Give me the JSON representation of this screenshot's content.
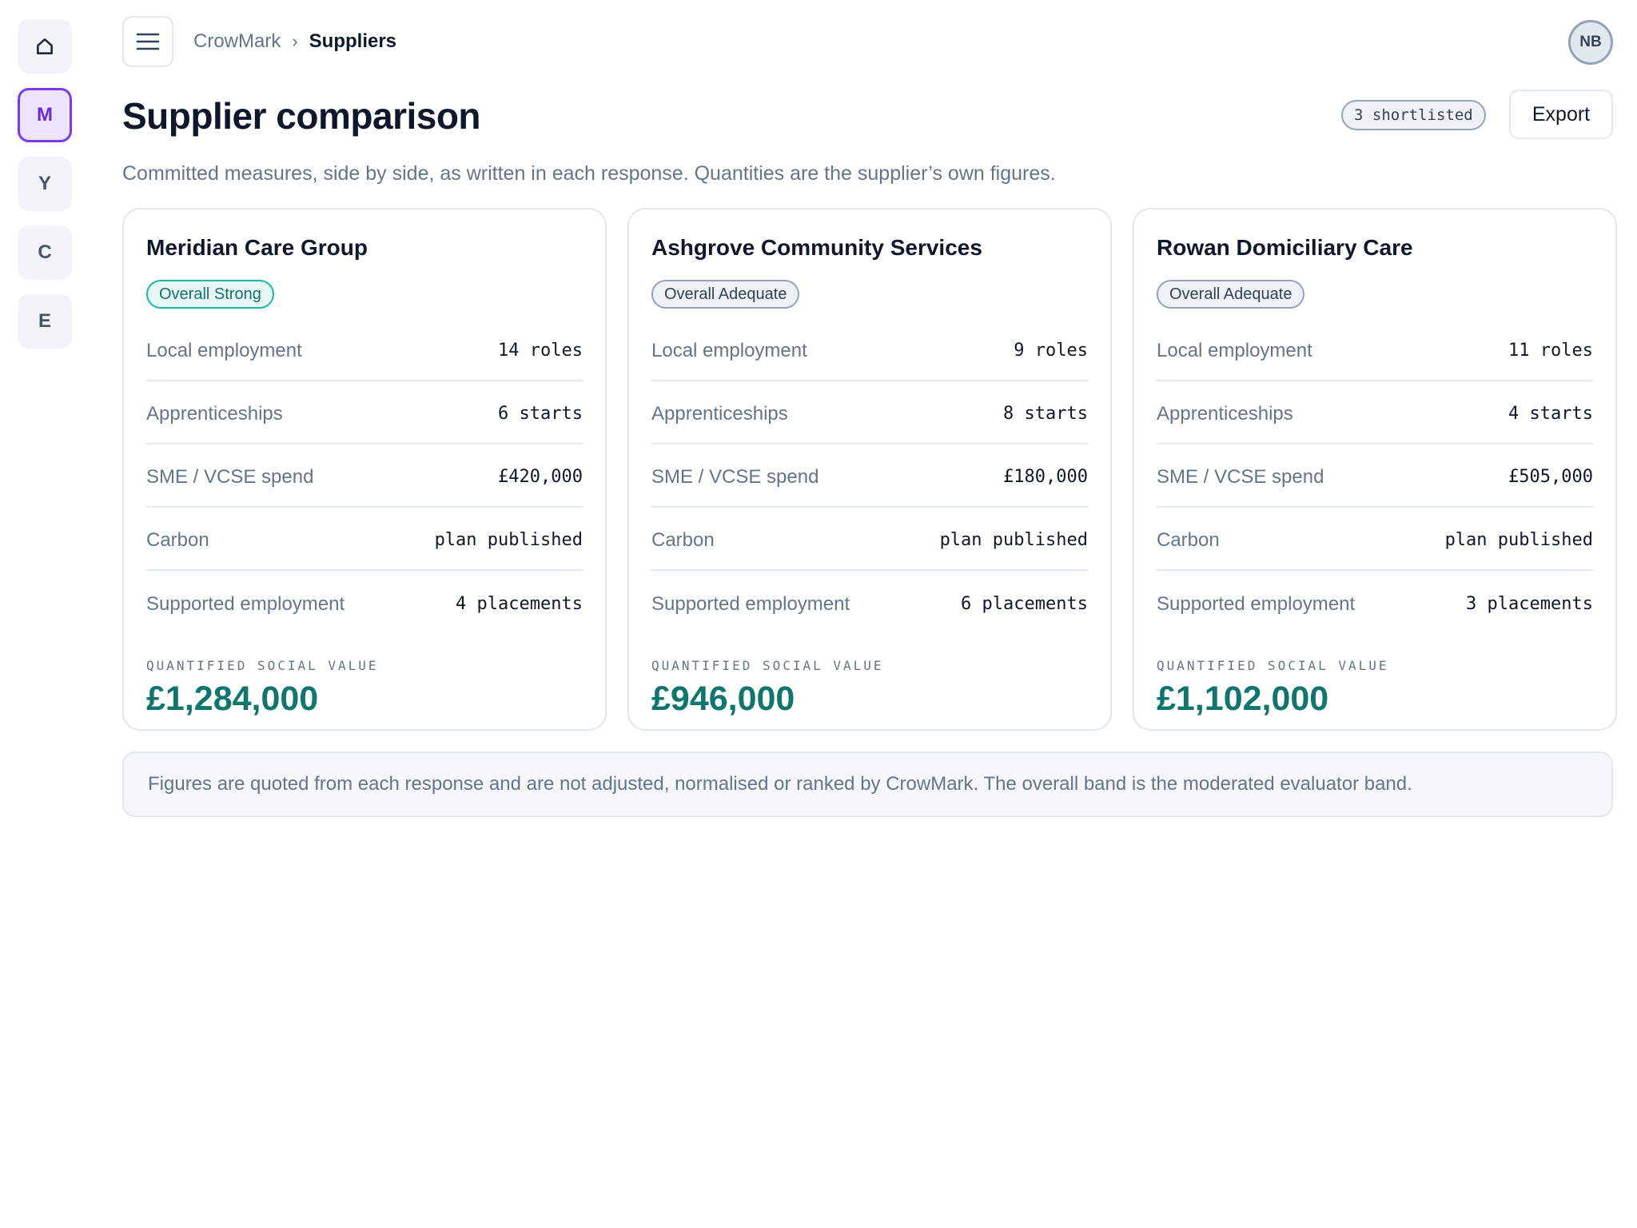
{
  "rail": {
    "items": [
      {
        "label": "",
        "icon": "home-icon"
      },
      {
        "label": "M",
        "active": true
      },
      {
        "label": "Y"
      },
      {
        "label": "C"
      },
      {
        "label": "E"
      }
    ]
  },
  "topbar": {
    "breadcrumb": {
      "root": "CrowMark",
      "separator": "›",
      "current": "Suppliers"
    },
    "avatar": "NB"
  },
  "header": {
    "title": "Supplier comparison",
    "shortlisted_badge": "3 shortlisted",
    "export_label": "Export",
    "subtitle": "Committed measures, side by side, as written in each response. Quantities are the supplier’s own figures."
  },
  "suppliers": [
    {
      "name": "Meridian Care Group",
      "band": "Overall Strong",
      "band_color": "#0f766e",
      "metrics": [
        {
          "label": "Local employment",
          "value": "14 roles"
        },
        {
          "label": "Apprenticeships",
          "value": "6 starts"
        },
        {
          "label": "SME / VCSE spend",
          "value": "£420,000"
        },
        {
          "label": "Carbon",
          "value": "plan published"
        },
        {
          "label": "Supported employment",
          "value": "4 placements"
        }
      ],
      "qsv_label": "QUANTIFIED SOCIAL VALUE",
      "qsv_value": "£1,284,000"
    },
    {
      "name": "Ashgrove Community Services",
      "band": "Overall Adequate",
      "band_color": "#334155",
      "metrics": [
        {
          "label": "Local employment",
          "value": "9 roles"
        },
        {
          "label": "Apprenticeships",
          "value": "8 starts"
        },
        {
          "label": "SME / VCSE spend",
          "value": "£180,000"
        },
        {
          "label": "Carbon",
          "value": "plan published"
        },
        {
          "label": "Supported employment",
          "value": "6 placements"
        }
      ],
      "qsv_label": "QUANTIFIED SOCIAL VALUE",
      "qsv_value": "£946,000"
    },
    {
      "name": "Rowan Domiciliary Care",
      "band": "Overall Adequate",
      "band_color": "#334155",
      "metrics": [
        {
          "label": "Local employment",
          "value": "11 roles"
        },
        {
          "label": "Apprenticeships",
          "value": "4 starts"
        },
        {
          "label": "SME / VCSE spend",
          "value": "£505,000"
        },
        {
          "label": "Carbon",
          "value": "plan published"
        },
        {
          "label": "Supported employment",
          "value": "3 placements"
        }
      ],
      "qsv_label": "QUANTIFIED SOCIAL VALUE",
      "qsv_value": "£1,102,000"
    }
  ],
  "footnote": "Figures are quoted from each response and are not adjusted, normalised or ranked by CrowMark. The overall band is the moderated evaluator band.",
  "colors": {
    "accent": "#7c3aed",
    "positive": "#0f766e",
    "muted_text": "#64748b"
  }
}
